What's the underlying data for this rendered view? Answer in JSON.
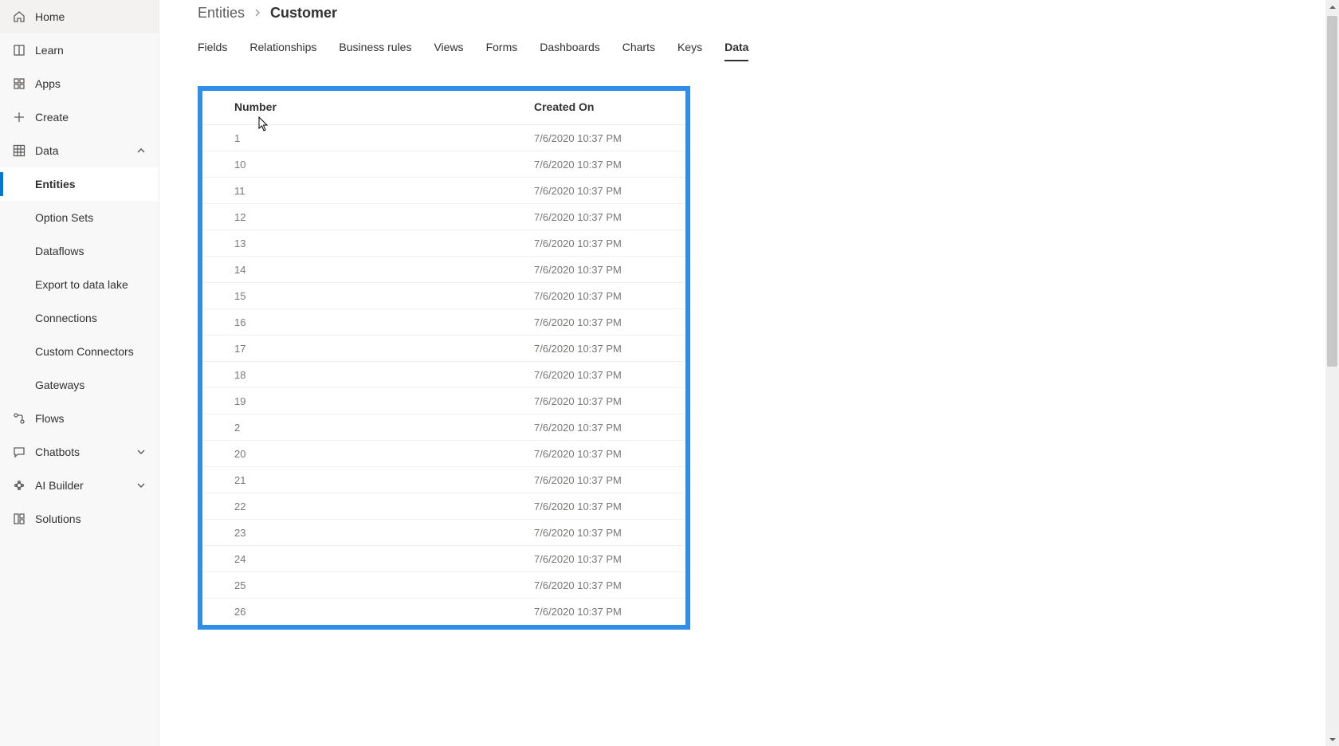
{
  "sidebar": {
    "top": [
      {
        "id": "home",
        "label": "Home",
        "icon": "home"
      },
      {
        "id": "learn",
        "label": "Learn",
        "icon": "book"
      },
      {
        "id": "apps",
        "label": "Apps",
        "icon": "apps"
      },
      {
        "id": "create",
        "label": "Create",
        "icon": "plus"
      }
    ],
    "data": {
      "label": "Data",
      "children": [
        {
          "id": "entities",
          "label": "Entities",
          "selected": true
        },
        {
          "id": "optionsets",
          "label": "Option Sets"
        },
        {
          "id": "dataflows",
          "label": "Dataflows"
        },
        {
          "id": "export",
          "label": "Export to data lake"
        },
        {
          "id": "connections",
          "label": "Connections"
        },
        {
          "id": "customconnectors",
          "label": "Custom Connectors"
        },
        {
          "id": "gateways",
          "label": "Gateways"
        }
      ]
    },
    "bottom": [
      {
        "id": "flows",
        "label": "Flows",
        "icon": "flow"
      },
      {
        "id": "chatbots",
        "label": "Chatbots",
        "icon": "chat",
        "chevron": true
      },
      {
        "id": "aibuilder",
        "label": "AI Builder",
        "icon": "ai",
        "chevron": true
      },
      {
        "id": "solutions",
        "label": "Solutions",
        "icon": "solutions"
      }
    ]
  },
  "breadcrumb": {
    "parent": "Entities",
    "current": "Customer"
  },
  "tabs": [
    {
      "id": "fields",
      "label": "Fields"
    },
    {
      "id": "relationships",
      "label": "Relationships"
    },
    {
      "id": "businessrules",
      "label": "Business rules"
    },
    {
      "id": "views",
      "label": "Views"
    },
    {
      "id": "forms",
      "label": "Forms"
    },
    {
      "id": "dashboards",
      "label": "Dashboards"
    },
    {
      "id": "charts",
      "label": "Charts"
    },
    {
      "id": "keys",
      "label": "Keys"
    },
    {
      "id": "data",
      "label": "Data",
      "active": true
    }
  ],
  "table": {
    "columns": {
      "number": "Number",
      "created": "Created On"
    },
    "rows": [
      {
        "number": "1",
        "created": "7/6/2020 10:37 PM"
      },
      {
        "number": "10",
        "created": "7/6/2020 10:37 PM"
      },
      {
        "number": "11",
        "created": "7/6/2020 10:37 PM"
      },
      {
        "number": "12",
        "created": "7/6/2020 10:37 PM"
      },
      {
        "number": "13",
        "created": "7/6/2020 10:37 PM"
      },
      {
        "number": "14",
        "created": "7/6/2020 10:37 PM"
      },
      {
        "number": "15",
        "created": "7/6/2020 10:37 PM"
      },
      {
        "number": "16",
        "created": "7/6/2020 10:37 PM"
      },
      {
        "number": "17",
        "created": "7/6/2020 10:37 PM"
      },
      {
        "number": "18",
        "created": "7/6/2020 10:37 PM"
      },
      {
        "number": "19",
        "created": "7/6/2020 10:37 PM"
      },
      {
        "number": "2",
        "created": "7/6/2020 10:37 PM"
      },
      {
        "number": "20",
        "created": "7/6/2020 10:37 PM"
      },
      {
        "number": "21",
        "created": "7/6/2020 10:37 PM"
      },
      {
        "number": "22",
        "created": "7/6/2020 10:37 PM"
      },
      {
        "number": "23",
        "created": "7/6/2020 10:37 PM"
      },
      {
        "number": "24",
        "created": "7/6/2020 10:37 PM"
      },
      {
        "number": "25",
        "created": "7/6/2020 10:37 PM"
      },
      {
        "number": "26",
        "created": "7/6/2020 10:37 PM"
      }
    ]
  }
}
